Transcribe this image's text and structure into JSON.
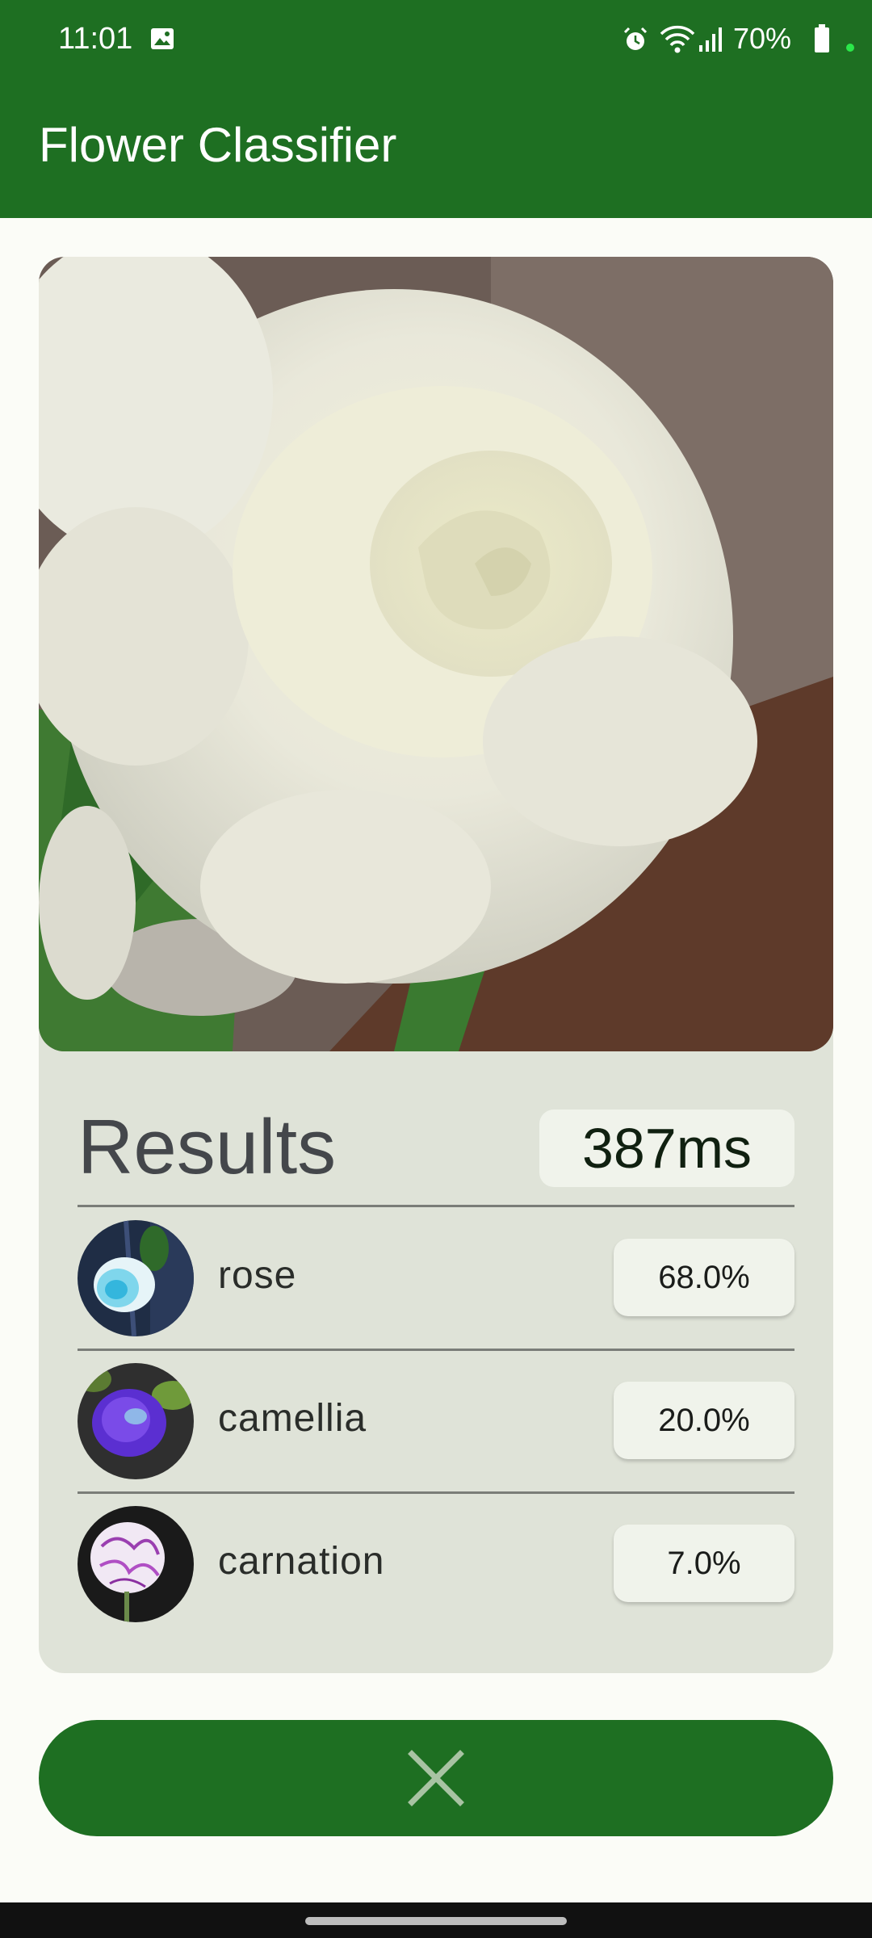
{
  "status_bar": {
    "time": "11:01",
    "battery": "70%"
  },
  "app_bar": {
    "title": "Flower Classifier"
  },
  "results": {
    "title": "Results",
    "inference_time": "387ms",
    "items": [
      {
        "label": "rose",
        "score": "68.0%",
        "thumb_icon": "rose-thumbnail"
      },
      {
        "label": "camellia",
        "score": "20.0%",
        "thumb_icon": "camellia-thumbnail"
      },
      {
        "label": "carnation",
        "score": "7.0%",
        "thumb_icon": "carnation-thumbnail"
      }
    ]
  },
  "actions": {
    "close_icon": "close-icon"
  },
  "colors": {
    "primary": "#1e6f22",
    "card": "#dfe3d8",
    "chip": "#f0f3eb",
    "background": "#fbfcf7"
  }
}
